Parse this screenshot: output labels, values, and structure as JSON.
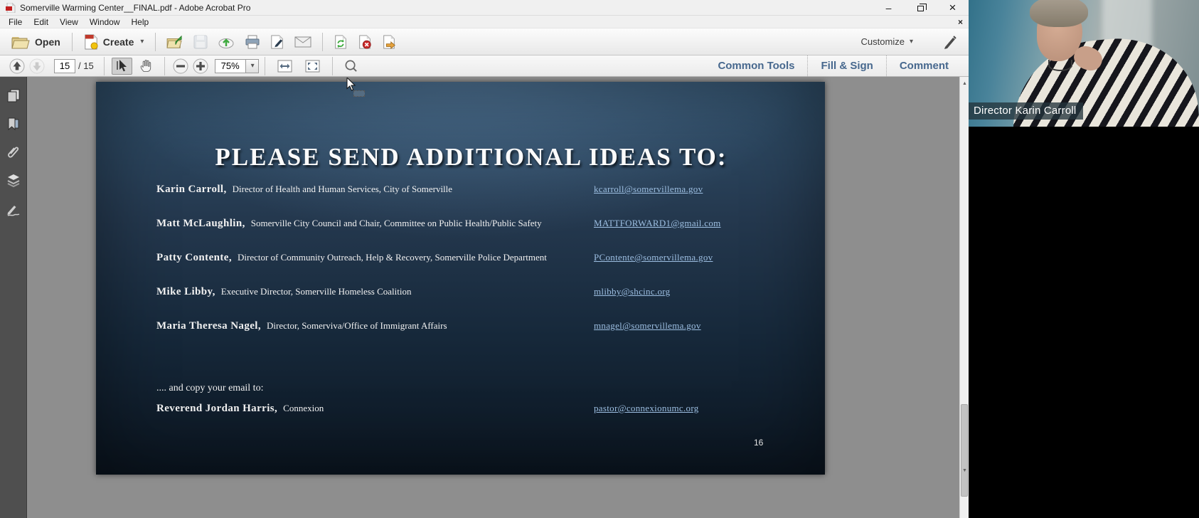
{
  "window": {
    "title": "Somerville Warming Center__FINAL.pdf - Adobe Acrobat Pro",
    "menu": [
      "File",
      "Edit",
      "View",
      "Window",
      "Help"
    ]
  },
  "toolbar": {
    "open": "Open",
    "create": "Create",
    "customize": "Customize"
  },
  "nav": {
    "page": "15",
    "page_total": "/ 15",
    "zoom": "75%",
    "tabs": [
      "Common Tools",
      "Fill & Sign",
      "Comment"
    ]
  },
  "slide": {
    "title": "PLEASE SEND ADDITIONAL IDEAS TO:",
    "contacts": [
      {
        "name": "Karin Carroll,",
        "role": "Director of Health and Human Services, City of Somerville",
        "email": "kcarroll@somervillema.gov"
      },
      {
        "name": "Matt McLaughlin,",
        "role": "Somerville City Council and Chair, Committee on Public Health/Public Safety",
        "email": "MATTFORWARD1@gmail.com"
      },
      {
        "name": "Patty Contente,",
        "role": "Director of Community Outreach, Help & Recovery, Somerville Police Department",
        "email": "PContente@somervillema.gov"
      },
      {
        "name": "Mike Libby,",
        "role": "Executive Director, Somerville Homeless Coalition",
        "email": "mlibby@shcinc.org"
      },
      {
        "name": "Maria Theresa Nagel,",
        "role": "Director, Somerviva/Office of Immigrant Affairs",
        "email": "mnagel@somervillema.gov"
      }
    ],
    "copy_note": ".... and copy your email to:",
    "extra": {
      "name": "Reverend Jordan Harris,",
      "role": "Connexion",
      "email": "pastor@connexionumc.org"
    },
    "page_number": "16"
  },
  "video": {
    "label": "Director Karin Carroll"
  },
  "icons": {
    "caret_down": "▾",
    "minimize_glyph": "–",
    "close_glyph": "×",
    "scroll_up": "▲",
    "scroll_down": "▼"
  },
  "colors": {
    "tab_blue": "#47688e",
    "link_blue": "#9dbfe2",
    "slide_top": "#31506b",
    "slide_bottom": "#0b1520",
    "sidebar_gray": "#4f4f4f",
    "doc_bg": "#8e8e8e"
  }
}
